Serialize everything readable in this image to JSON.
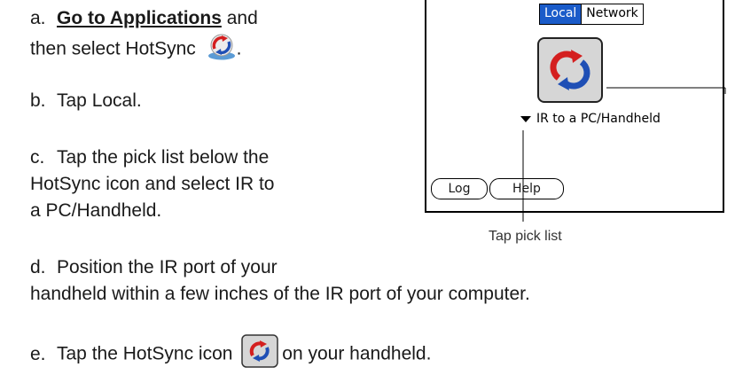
{
  "steps": [
    {
      "letter": "a.",
      "link_text": "Go to Applications",
      "text_after_link": " and",
      "line2": "then select HotSync",
      "line2_after_icon": "."
    },
    {
      "letter": "b.",
      "text": "Tap Local."
    },
    {
      "letter": "c.",
      "line1": "Tap the pick list below the",
      "line2": "HotSync icon and select IR to",
      "line3": "a PC/Handheld."
    },
    {
      "letter": "d.",
      "line1": "Position the IR port of your",
      "line2": "handheld within a few inches of the IR port of your computer."
    },
    {
      "letter": "e.",
      "text_before_icon": "Tap the HotSync icon",
      "text_after_icon": "on your handheld."
    }
  ],
  "handheld": {
    "segment": {
      "local": "Local",
      "network": "Network",
      "selected": "Local"
    },
    "picklist_value": "IR to a PC/Handheld",
    "log_button": "Log",
    "help_button": "Help"
  },
  "caption": "Tap pick list",
  "colors": {
    "selected_segment": "#1a5bc9",
    "icon_red": "#d41f1f",
    "icon_blue": "#1f4fb5"
  }
}
